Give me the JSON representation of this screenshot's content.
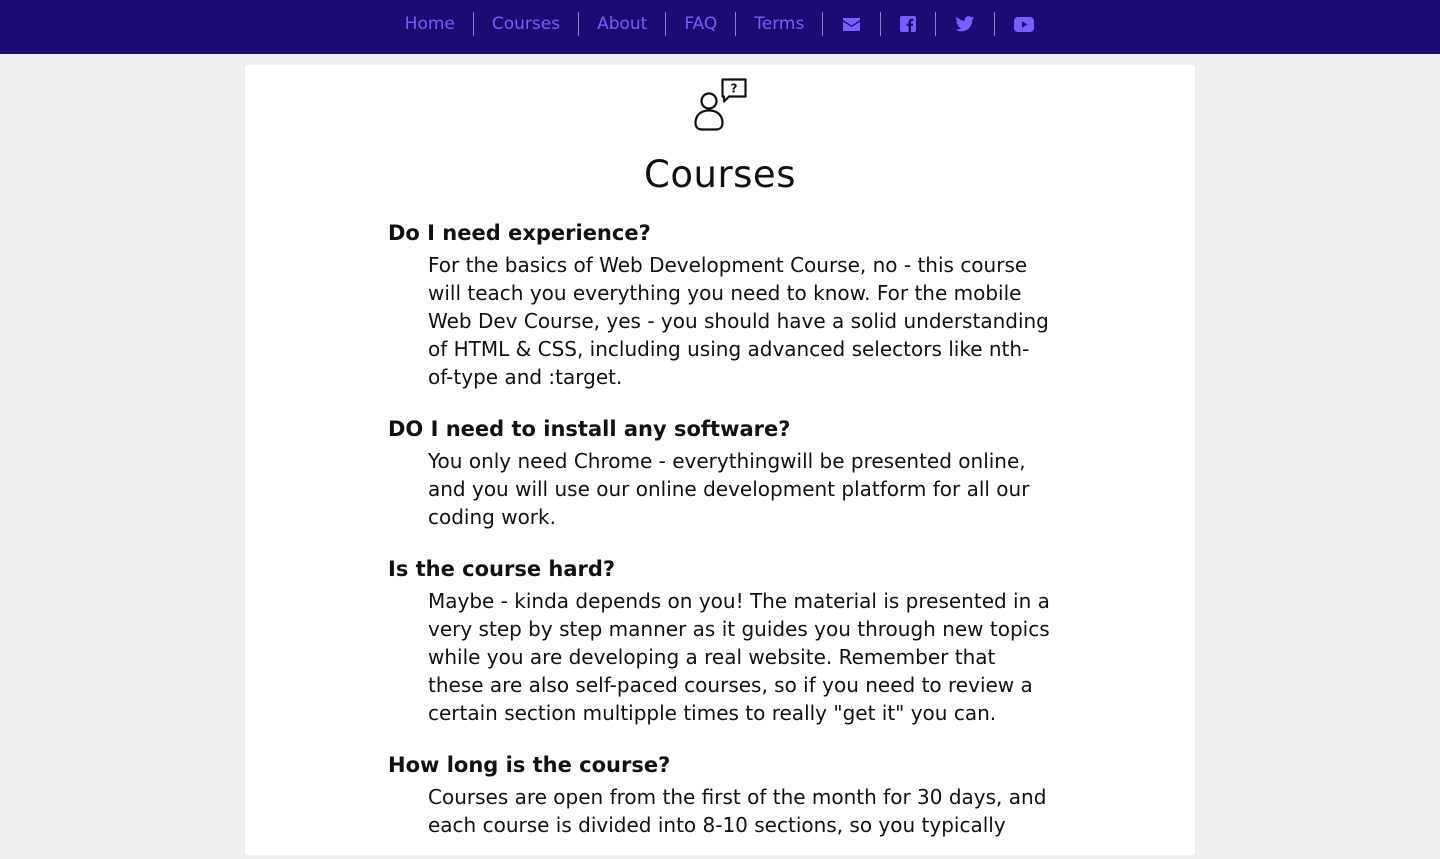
{
  "nav": {
    "items": [
      "Home",
      "Courses",
      "About",
      "FAQ",
      "Terms"
    ],
    "icons": [
      "envelope-icon",
      "facebook-icon",
      "twitter-icon",
      "youtube-icon"
    ]
  },
  "page": {
    "title": "Courses",
    "header_icon": "person-question-bubble-icon"
  },
  "faq": [
    {
      "q": "Do I need experience?",
      "a": "For the basics of Web Development Course, no - this course will teach you everything you need to know. For the mobile Web Dev Course, yes - you should have a solid understanding of HTML & CSS, including using advanced selectors like nth-of-type and :target."
    },
    {
      "q": "DO I need to install any software?",
      "a": "You only need Chrome - everythingwill be presented online, and you will use our online development platform for all our coding work."
    },
    {
      "q": "Is the course hard?",
      "a": "Maybe - kinda depends on you! The material is presented in a very step by step manner as it guides you through new topics while you are developing a real website. Remember that these are also self-paced courses, so if you need to review a certain section multipple times to really \"get it\" you can."
    },
    {
      "q": "How long is the course?",
      "a": "Courses are open from the first of the month for 30 days, and each course is divided into 8-10 sections, so you typically"
    }
  ],
  "colors": {
    "nav_bg": "#1b0b72",
    "nav_link": "#7a5cff",
    "page_bg": "#efefef",
    "card_bg": "#ffffff"
  }
}
